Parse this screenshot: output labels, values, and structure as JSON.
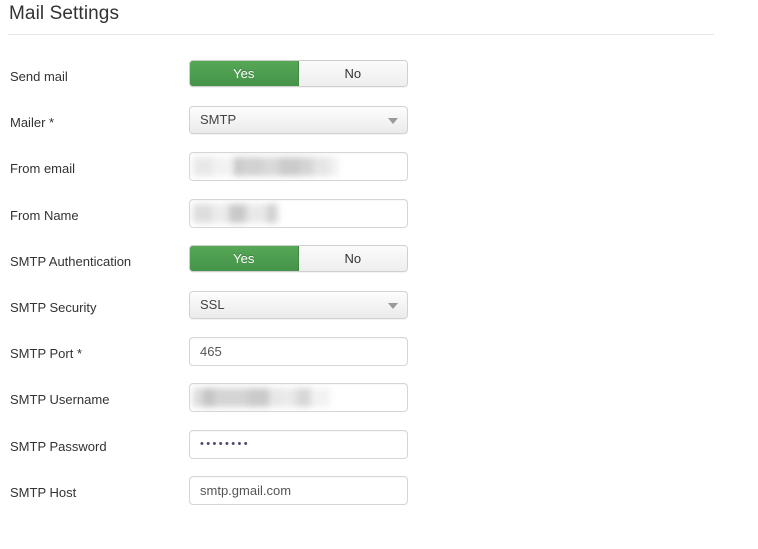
{
  "page": {
    "title": "Mail Settings"
  },
  "form": {
    "rows": [
      {
        "label": "Send mail",
        "type": "toggle",
        "name": "send-mail",
        "options": [
          "Yes",
          "No"
        ],
        "selected": "Yes"
      },
      {
        "label": "Mailer *",
        "type": "select",
        "name": "mailer",
        "value": "SMTP"
      },
      {
        "label": "From email",
        "type": "redacted",
        "name": "from-email",
        "value": ""
      },
      {
        "label": "From Name",
        "type": "redacted",
        "name": "from-name",
        "value": ""
      },
      {
        "label": "SMTP Authentication",
        "type": "toggle",
        "name": "smtp-authentication",
        "options": [
          "Yes",
          "No"
        ],
        "selected": "Yes"
      },
      {
        "label": "SMTP Security",
        "type": "select",
        "name": "smtp-security",
        "value": "SSL"
      },
      {
        "label": "SMTP Port *",
        "type": "input",
        "name": "smtp-port",
        "value": "465"
      },
      {
        "label": "SMTP Username",
        "type": "redacted",
        "name": "smtp-username",
        "value": ""
      },
      {
        "label": "SMTP Password",
        "type": "password",
        "name": "smtp-password",
        "value": "••••••••"
      },
      {
        "label": "SMTP Host",
        "type": "input",
        "name": "smtp-host",
        "value": "smtp.gmail.com"
      }
    ]
  },
  "colors": {
    "toggle_on": "#4a9c4a",
    "text": "#333333",
    "border": "#d6d6d6",
    "rule": "#e5e5e5"
  }
}
